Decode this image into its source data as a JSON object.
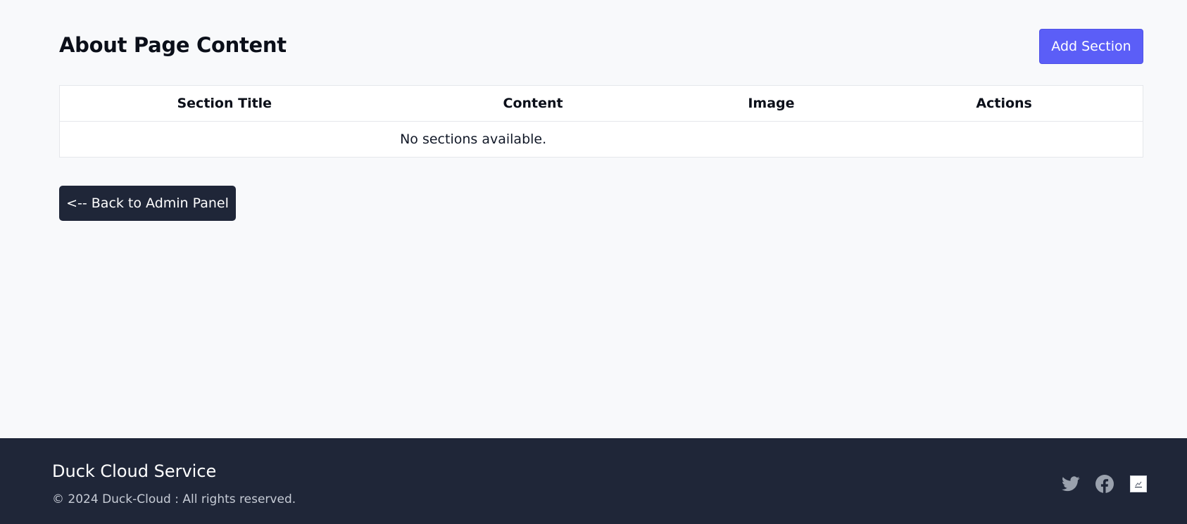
{
  "page": {
    "title": "About Page Content",
    "add_button_label": "Add Section"
  },
  "table": {
    "headers": [
      "Section Title",
      "Content",
      "Image",
      "Actions"
    ],
    "empty_message": "No sections available."
  },
  "back_button_label": "<-- Back to Admin Panel",
  "footer": {
    "brand": "Duck Cloud Service",
    "copyright": "© 2024 Duck-Cloud : All rights reserved.",
    "social_icons": [
      "twitter-icon",
      "facebook-icon",
      "image-icon"
    ]
  },
  "colors": {
    "accent": "#5b5ef7",
    "dark": "#1f2638",
    "background": "#f8f9fb"
  }
}
